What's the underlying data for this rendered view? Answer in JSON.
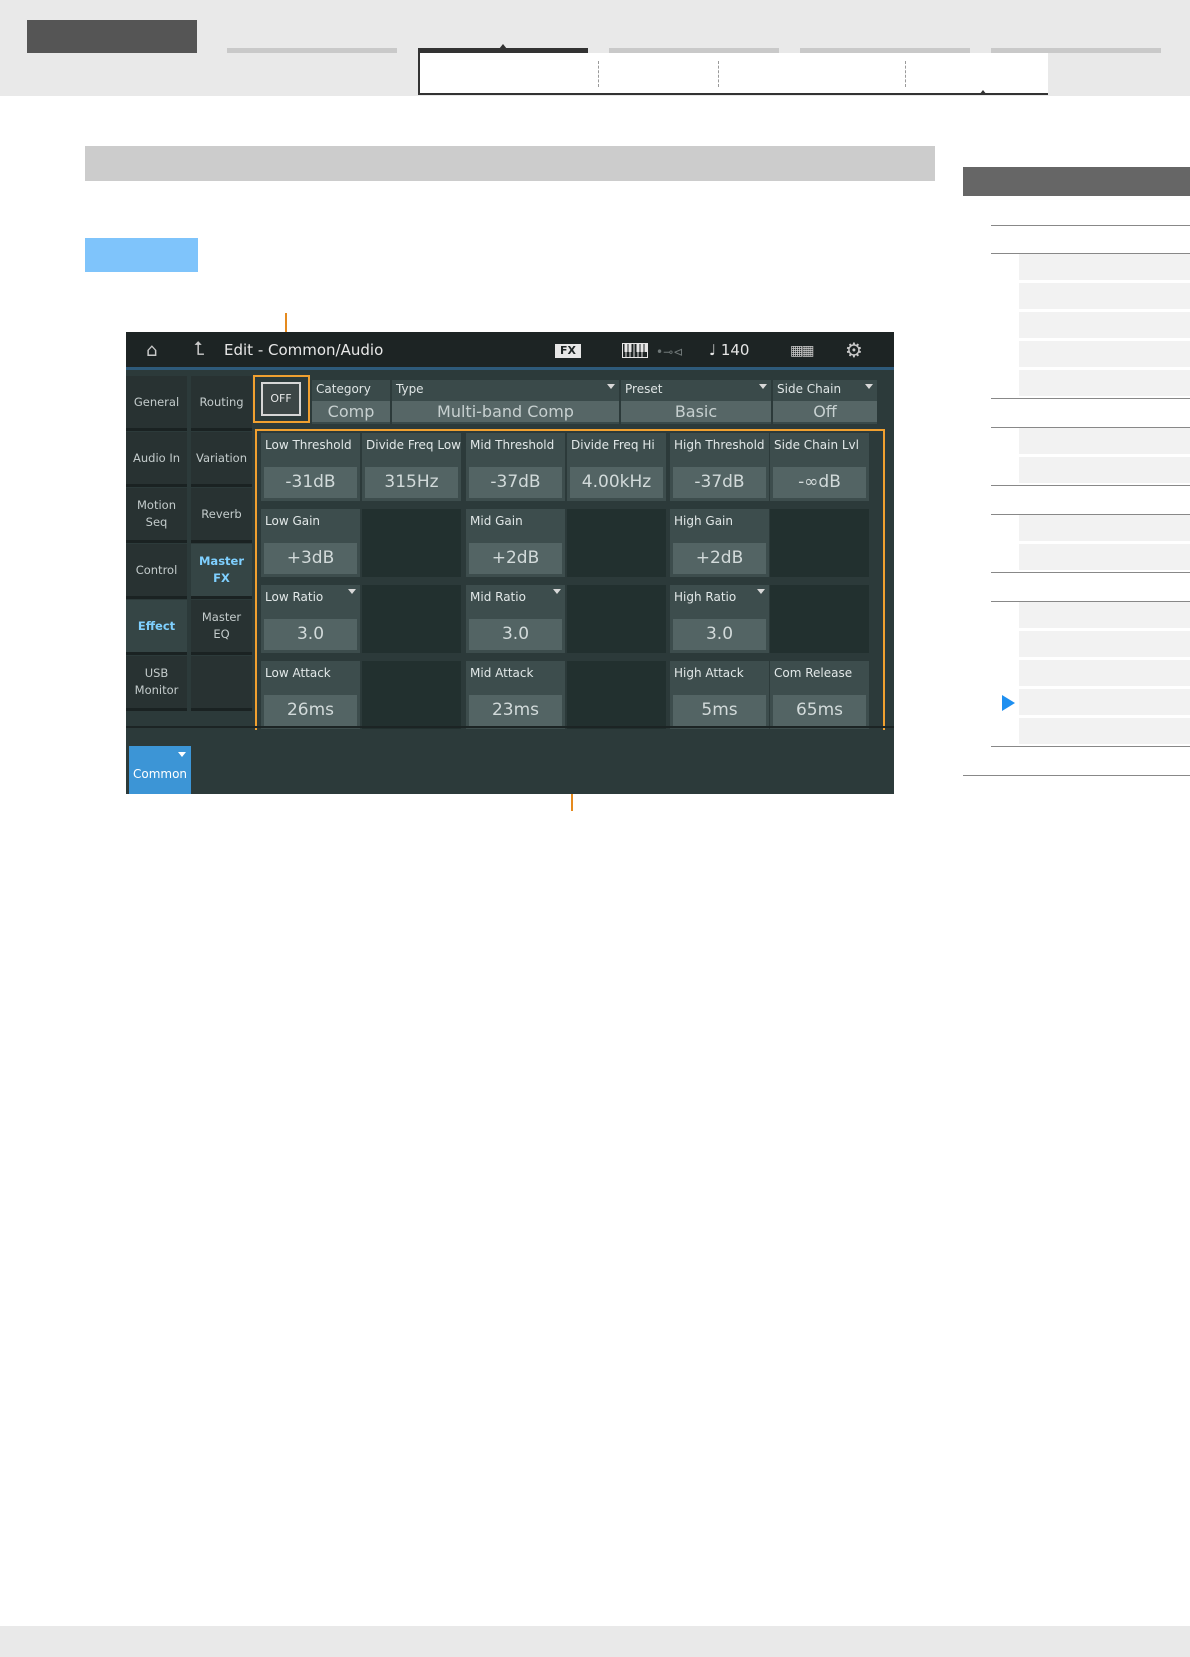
{
  "screen": {
    "header": {
      "title": "Edit - Common/Audio",
      "fx_badge": "FX",
      "tempo": "♩ 140"
    },
    "left_tabs": [
      "General",
      "Audio In",
      "Motion Seq",
      "Control",
      "Effect",
      "USB Monitor"
    ],
    "left_tabs_selected": "Effect",
    "sub_tabs": [
      "Routing",
      "Variation",
      "Reverb",
      "Master FX",
      "Master EQ"
    ],
    "sub_tabs_selected": "Master FX",
    "switch": "OFF",
    "effect_header": [
      {
        "label": "Category",
        "value": "Comp",
        "dropdown": false
      },
      {
        "label": "Type",
        "value": "Multi-band Comp",
        "dropdown": true
      },
      {
        "label": "Preset",
        "value": "Basic",
        "dropdown": true
      },
      {
        "label": "Side Chain",
        "value": "Off",
        "dropdown": true
      }
    ],
    "params": [
      [
        {
          "label": "Low Threshold",
          "value": "-31dB"
        },
        {
          "label": "Divide Freq Low",
          "value": "315Hz"
        },
        {
          "label": "Mid Threshold",
          "value": "-37dB"
        },
        {
          "label": "Divide Freq Hi",
          "value": "4.00kHz"
        },
        {
          "label": "High Threshold",
          "value": "-37dB"
        },
        {
          "label": "Side Chain Lvl",
          "value": "-∞dB"
        }
      ],
      [
        {
          "label": "Low Gain",
          "value": "+3dB"
        },
        null,
        {
          "label": "Mid Gain",
          "value": "+2dB"
        },
        null,
        {
          "label": "High Gain",
          "value": "+2dB"
        },
        null
      ],
      [
        {
          "label": "Low Ratio",
          "value": "3.0",
          "dropdown": true
        },
        null,
        {
          "label": "Mid Ratio",
          "value": "3.0",
          "dropdown": true
        },
        null,
        {
          "label": "High Ratio",
          "value": "3.0",
          "dropdown": true
        },
        null
      ],
      [
        {
          "label": "Low Attack",
          "value": "26ms"
        },
        null,
        {
          "label": "Mid Attack",
          "value": "23ms"
        },
        null,
        {
          "label": "High Attack",
          "value": "5ms"
        },
        {
          "label": "Com Release",
          "value": "65ms"
        }
      ]
    ],
    "bottom_tab": "Common"
  },
  "colors": {
    "callout": "#e58a1e",
    "selected_tab_text": "#7fd0ff",
    "common_tab": "#3c95d6",
    "index_arrow": "#1e8ff0"
  },
  "icons": [
    "home-icon",
    "back-icon",
    "keyboard-icon",
    "usb-icon",
    "grid-icon",
    "gear-icon",
    "dropdown-icon",
    "play-arrow-icon"
  ]
}
